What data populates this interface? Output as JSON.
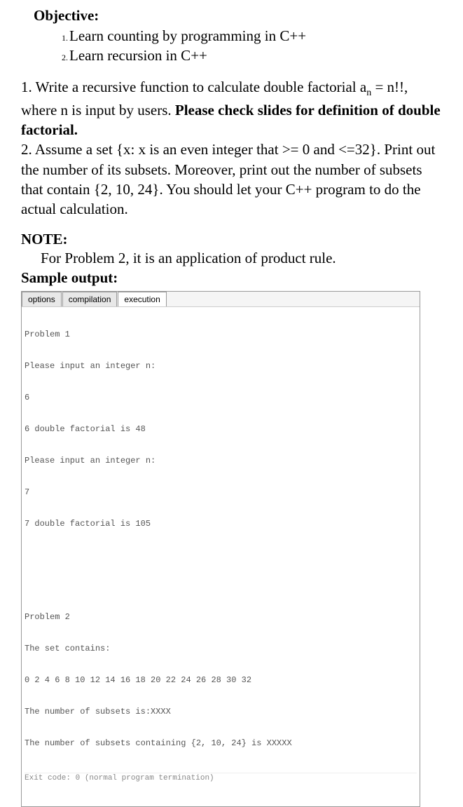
{
  "objective": {
    "heading": "Objective:",
    "items": [
      "Learn counting by programming in C++",
      "Learn recursion in C++"
    ]
  },
  "problems": {
    "p1_part1": "1. Write a recursive function to calculate double factorial a",
    "p1_sub": "n",
    "p1_part2": " = n!!, where n is input by users. ",
    "p1_bold": "Please check slides for definition of double factorial.",
    "p2": "2. Assume a set {x: x is an even integer that >= 0 and <=32}. Print out the number of its subsets. Moreover, print out the number of subsets that contain {2, 10, 24}. You should let your C++ program to do the actual calculation."
  },
  "note": {
    "heading": "NOTE:",
    "text": "For Problem 2, it is an application of product rule."
  },
  "sample": {
    "heading": "Sample output:",
    "tabs": [
      "options",
      "compilation",
      "execution"
    ],
    "active_tab": "execution",
    "console": {
      "p1_header": "Problem 1",
      "p1_prompt1": "Please input an integer n:",
      "p1_input1": "6",
      "p1_result1": "6 double factorial is 48",
      "p1_prompt2": "Please input an integer n:",
      "p1_input2": "7",
      "p1_result2": "7 double factorial is 105",
      "p2_header": "Problem 2",
      "p2_set_label": "The set contains:",
      "p2_set": "0 2 4 6 8 10 12 14 16 18 20 22 24 26 28 30 32",
      "p2_subsets": "The number of subsets is:XXXX",
      "p2_containing": "The number of subsets containing {2, 10, 24} is XXXXX",
      "exit": "Exit code: 0 (normal program termination)"
    }
  }
}
